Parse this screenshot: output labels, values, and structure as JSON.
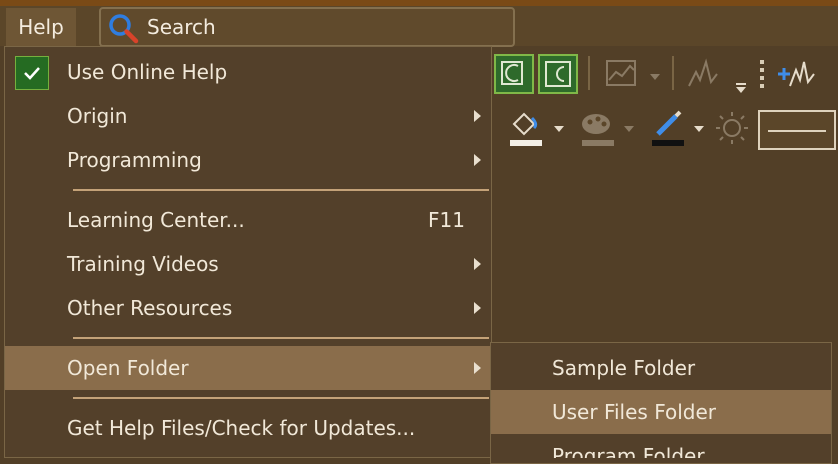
{
  "menubar": {
    "help": "Help",
    "search_placeholder": "Search"
  },
  "help_menu": {
    "items": [
      {
        "label": "Use Online Help",
        "checked": true
      },
      {
        "label": "Origin"
      },
      {
        "label": "Programming"
      },
      {
        "label": "Learning Center...",
        "shortcut": "F11"
      },
      {
        "label": "Training Videos"
      },
      {
        "label": "Other Resources"
      },
      {
        "label": "Open Folder",
        "highlighted": true
      },
      {
        "label": "Get Help Files/Check for Updates..."
      }
    ]
  },
  "open_folder_submenu": {
    "items": [
      {
        "label": "Sample Folder"
      },
      {
        "label": "User Files Folder",
        "highlighted": true
      },
      {
        "label": "Program Folder"
      }
    ]
  },
  "colors": {
    "background": "#523f27",
    "highlight": "#8a6d4b",
    "check_green": "#256b22",
    "accent_orange": "#7a4a16"
  }
}
